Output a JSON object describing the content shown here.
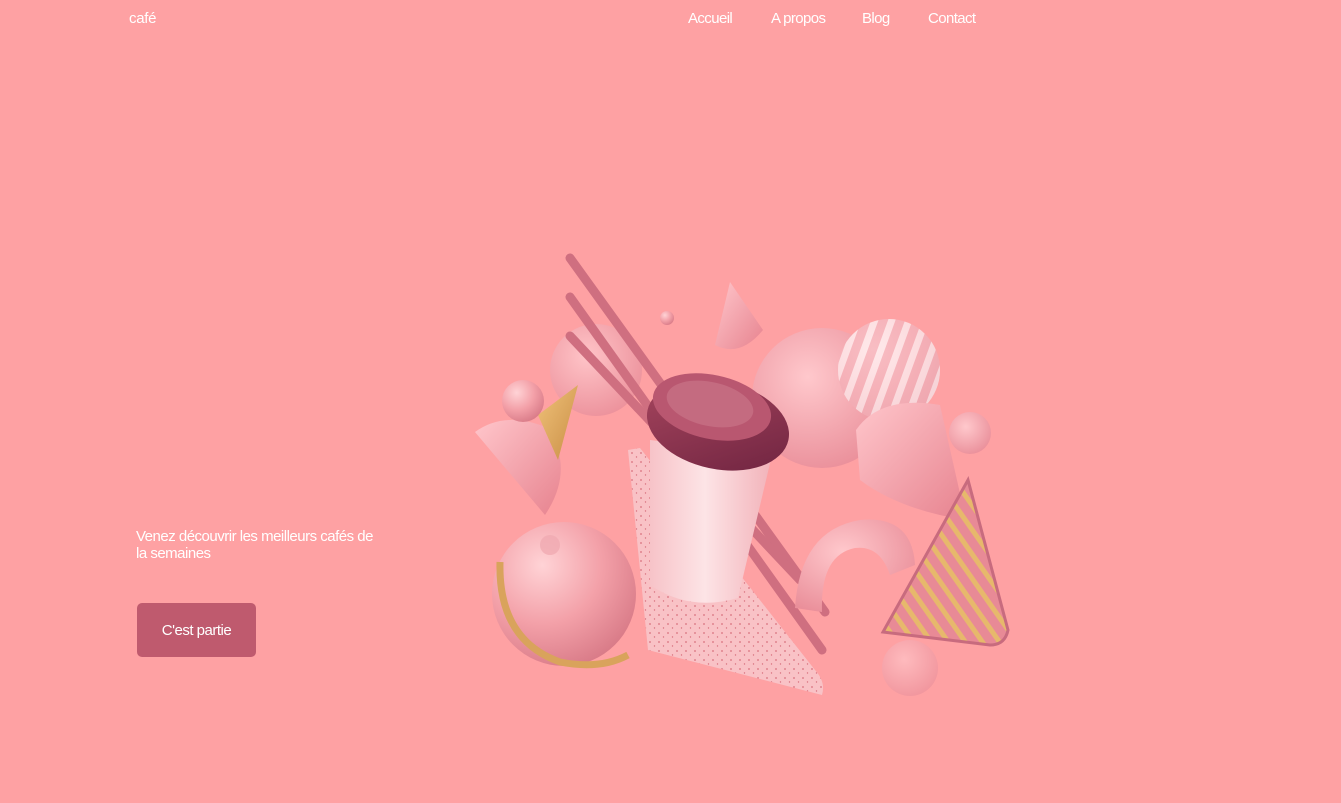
{
  "brand": {
    "name": "café"
  },
  "nav": {
    "items": [
      {
        "label": "Accueil"
      },
      {
        "label": "A propos"
      },
      {
        "label": "Blog"
      },
      {
        "label": "Contact"
      }
    ]
  },
  "hero": {
    "tagline": "Venez découvrir les meilleurs cafés de la semaines",
    "cta_label": "C'est partie",
    "illustration": {
      "subject": "coffee-cup-with-3d-shapes-illustration",
      "colors": {
        "pink": "#f6a3ab",
        "cup_lid": "#8c3450",
        "gold": "#d7a35c",
        "button": "#bf5a6e",
        "background": "#fea1a3"
      }
    }
  }
}
